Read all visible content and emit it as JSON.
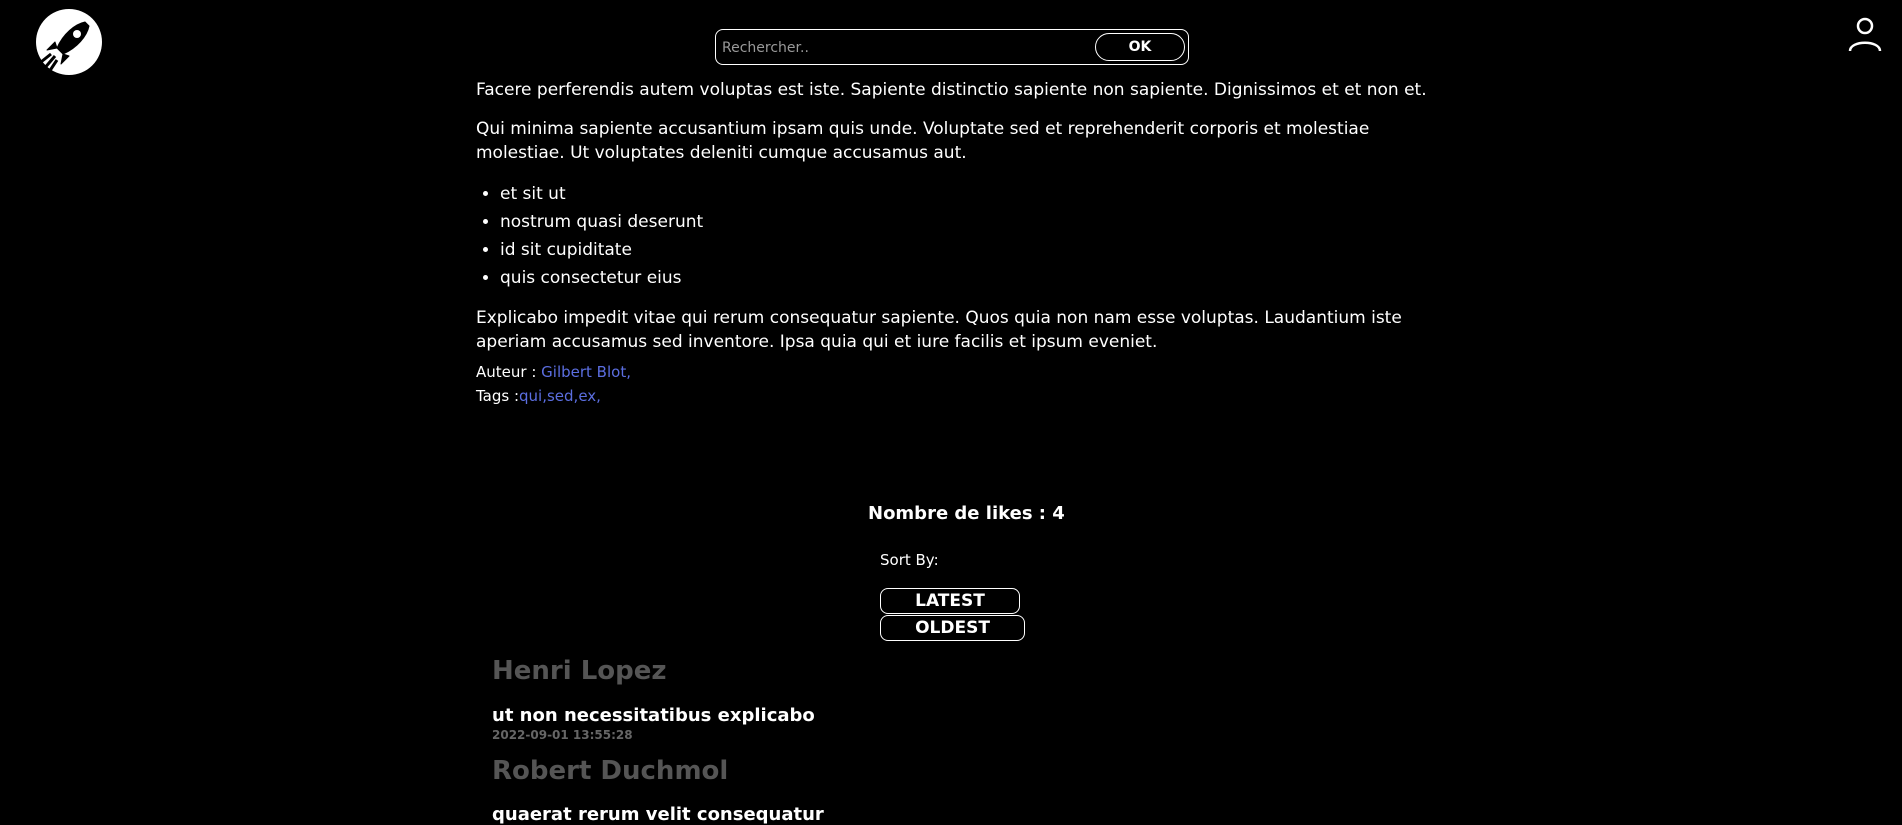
{
  "header": {
    "search_placeholder": "Rechercher..",
    "search_button": "OK"
  },
  "article": {
    "cut_line": "Facere perferendis autem voluptas est iste. Sapiente distinctio sapiente non sapiente. Dignissimos et et non et.",
    "paragraph1": "Qui minima sapiente accusantium ipsam quis unde. Voluptate sed et reprehenderit corporis et molestiae molestiae. Ut voluptates deleniti cumque accusamus aut.",
    "bullets": [
      "et sit ut",
      "nostrum quasi deserunt",
      "id sit cupiditate",
      "quis consectetur eius"
    ],
    "paragraph2": "Explicabo impedit vitae qui rerum consequatur sapiente. Quos quia non nam esse voluptas. Laudantium iste aperiam accusamus sed inventore. Ipsa quia qui et iure facilis et ipsum eveniet.",
    "author_label": "Auteur : ",
    "author_name": "Gilbert Blot,",
    "tags_label": "Tags :",
    "tags": "qui,sed,ex,"
  },
  "likes": {
    "text": "Nombre de likes : 4"
  },
  "sort": {
    "label": "Sort By:",
    "latest": "LATEST",
    "oldest": "OLDEST"
  },
  "comments": [
    {
      "author": "Henri Lopez",
      "text": "ut non necessitatibus explicabo",
      "date": "2022-09-01 13:55:28"
    },
    {
      "author": "Robert Duchmol",
      "text": "quaerat rerum velit consequatur"
    }
  ],
  "colors": {
    "background": "#000000",
    "link": "#5b6ee0",
    "comment_author": "#555555"
  },
  "icons": {
    "logo": "rocket-logo-icon",
    "user": "user-icon"
  }
}
